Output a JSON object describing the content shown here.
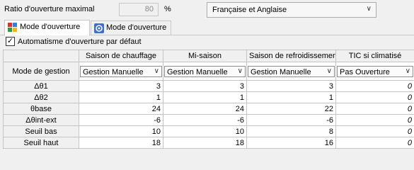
{
  "ratio": {
    "label": "Ratio d'ouverture maximal",
    "value": "80",
    "unit": "%"
  },
  "language": {
    "selected": "Française et Anglaise"
  },
  "tabs": [
    {
      "label": "Mode d'ouverture",
      "active": true,
      "icon": "grid-app-icon"
    },
    {
      "label": "Mode d'ouverture",
      "active": false,
      "icon": "gear-badge-icon"
    }
  ],
  "auto": {
    "label": "Automatisme d'ouverture par défaut",
    "checked": true
  },
  "table": {
    "row_header_title": "Mode de gestion",
    "columns": [
      "Saison de chauffage",
      "Mi-saison",
      "Saison de refroidissement",
      "TIC si climatisé"
    ],
    "modes": [
      "Gestion Manuelle",
      "Gestion Manuelle",
      "Gestion Manuelle",
      "Pas Ouverture"
    ],
    "rows": [
      {
        "label": "Δθ1",
        "values": [
          "3",
          "3",
          "3",
          "0"
        ]
      },
      {
        "label": "Δθ2",
        "values": [
          "1",
          "1",
          "1",
          "0"
        ]
      },
      {
        "label": "θbase",
        "values": [
          "24",
          "24",
          "22",
          "0"
        ]
      },
      {
        "label": "Δθint-ext",
        "values": [
          "-6",
          "-6",
          "-6",
          "0"
        ]
      },
      {
        "label": "Seuil bas",
        "values": [
          "10",
          "10",
          "8",
          "0"
        ]
      },
      {
        "label": "Seuil haut",
        "values": [
          "18",
          "18",
          "16",
          "0"
        ]
      }
    ]
  }
}
